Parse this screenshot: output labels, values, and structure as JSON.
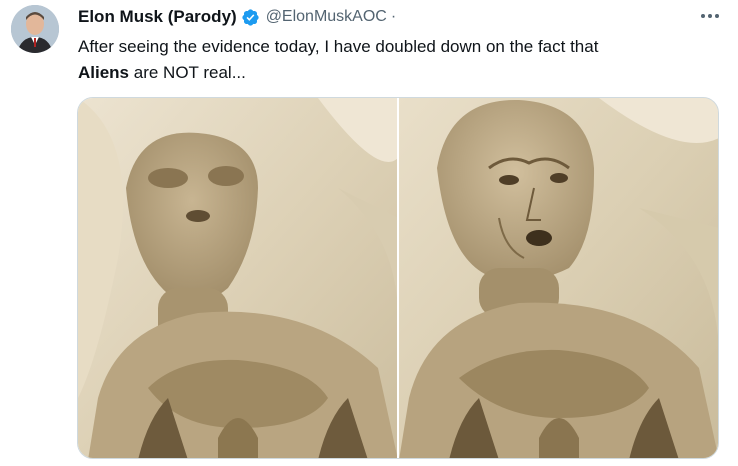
{
  "author": {
    "display_name": "Elon Musk (Parody)",
    "handle": "@ElonMuskAOC",
    "separator": "·",
    "verified_icon": "verified-badge-icon"
  },
  "tweet": {
    "text_line1": "After seeing the evidence today, I have doubled down on the fact that",
    "text_bold": "Aliens",
    "text_line2_rest": " are NOT real..."
  },
  "media": {
    "images": [
      "mummified-alien-figure",
      "mummified-figure-with-human-face"
    ]
  },
  "colors": {
    "verified_blue": "#1d9bf0",
    "secondary_text": "#536471",
    "border": "#cfd9de"
  }
}
